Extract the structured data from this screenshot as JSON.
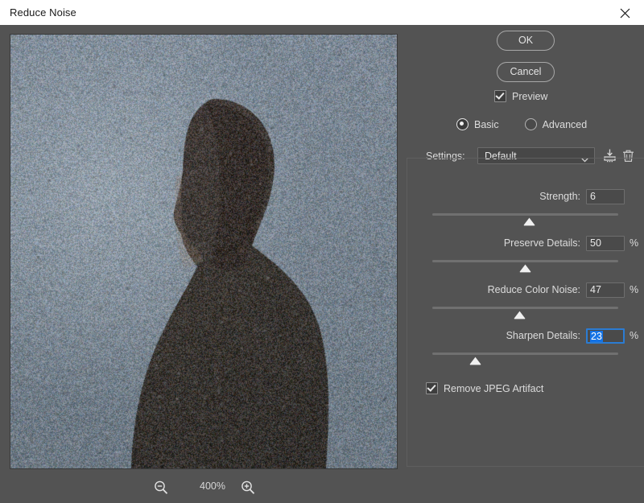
{
  "window": {
    "title": "Reduce Noise",
    "close_icon": "close-icon"
  },
  "preview": {
    "zoom_level": "400%",
    "zoom_out_icon": "zoom-out-icon",
    "zoom_in_icon": "zoom-in-icon"
  },
  "actions": {
    "ok_label": "OK",
    "cancel_label": "Cancel"
  },
  "preview_checkbox": {
    "label": "Preview",
    "checked": true
  },
  "mode": {
    "basic_label": "Basic",
    "advanced_label": "Advanced",
    "selected": "Basic"
  },
  "settings": {
    "label": "Settings:",
    "value": "Default",
    "save_icon": "save-preset-icon",
    "delete_icon": "trash-icon",
    "chevron_icon": "chevron-down-icon"
  },
  "sliders": [
    {
      "label": "Strength:",
      "value": "6",
      "unit": "",
      "percent": 52,
      "focused": false
    },
    {
      "label": "Preserve Details:",
      "value": "50",
      "unit": "%",
      "percent": 50,
      "focused": false
    },
    {
      "label": "Reduce Color Noise:",
      "value": "47",
      "unit": "%",
      "percent": 47,
      "focused": false
    },
    {
      "label": "Sharpen Details:",
      "value": "23",
      "unit": "%",
      "percent": 23,
      "focused": true
    }
  ],
  "jpeg_checkbox": {
    "label": "Remove JPEG Artifact",
    "checked": true
  },
  "colors": {
    "dialog_bg": "#535353",
    "titlebar_bg": "#ffffff",
    "accent_focus": "#2b7cd3",
    "selection": "#1473e6",
    "text": "#dcdcdc"
  }
}
